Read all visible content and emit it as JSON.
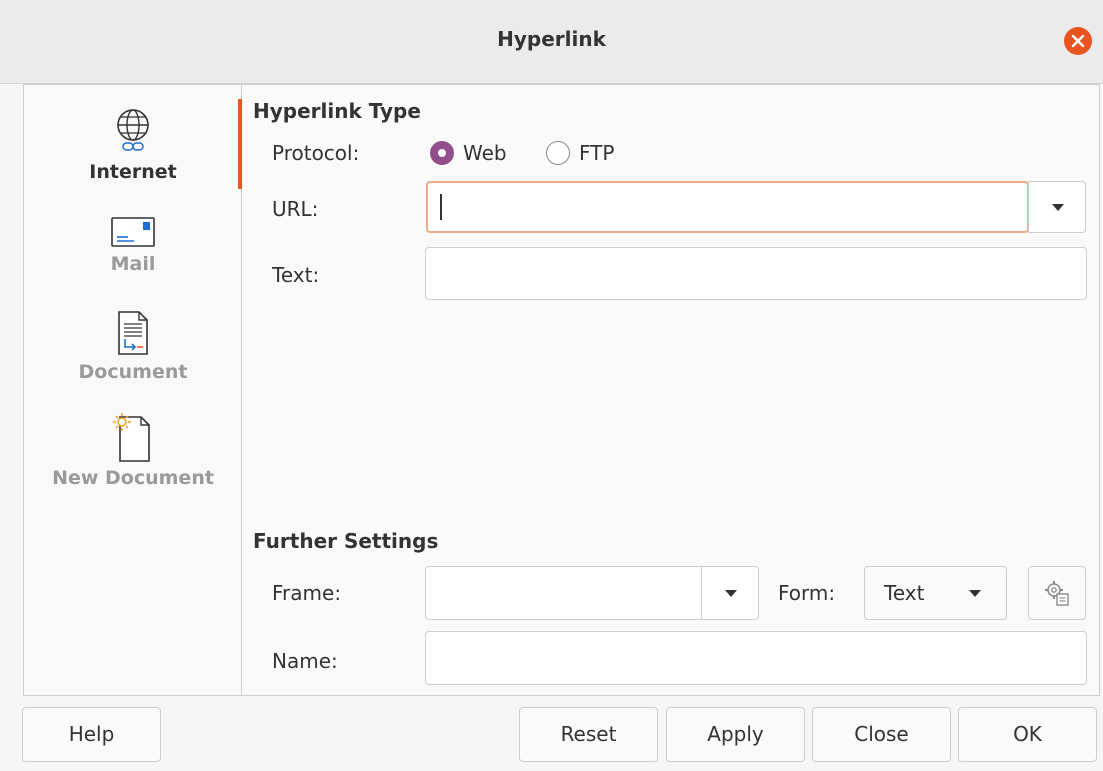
{
  "window": {
    "title": "Hyperlink"
  },
  "sidebar": {
    "items": [
      {
        "label": "Internet",
        "icon": "globe-link-icon",
        "active": true
      },
      {
        "label": "Mail",
        "icon": "envelope-icon",
        "active": false
      },
      {
        "label": "Document",
        "icon": "document-icon",
        "active": false
      },
      {
        "label": "New Document",
        "icon": "new-document-icon",
        "active": false
      }
    ]
  },
  "hyperlink_type": {
    "title": "Hyperlink Type",
    "protocol_label": "Protocol:",
    "protocol_options": [
      "Web",
      "FTP"
    ],
    "protocol_selected": "Web",
    "url_label": "URL:",
    "url_value": "",
    "text_label": "Text:",
    "text_value": ""
  },
  "further_settings": {
    "title": "Further Settings",
    "frame_label": "Frame:",
    "frame_value": "",
    "form_label": "Form:",
    "form_value": "Text",
    "name_label": "Name:",
    "name_value": ""
  },
  "buttons": {
    "help": "Help",
    "reset": "Reset",
    "apply": "Apply",
    "close": "Close",
    "ok": "OK"
  },
  "colors": {
    "accent": "#e95420",
    "radio_selected": "#924d8b",
    "focus_border": "#f0a98f"
  }
}
